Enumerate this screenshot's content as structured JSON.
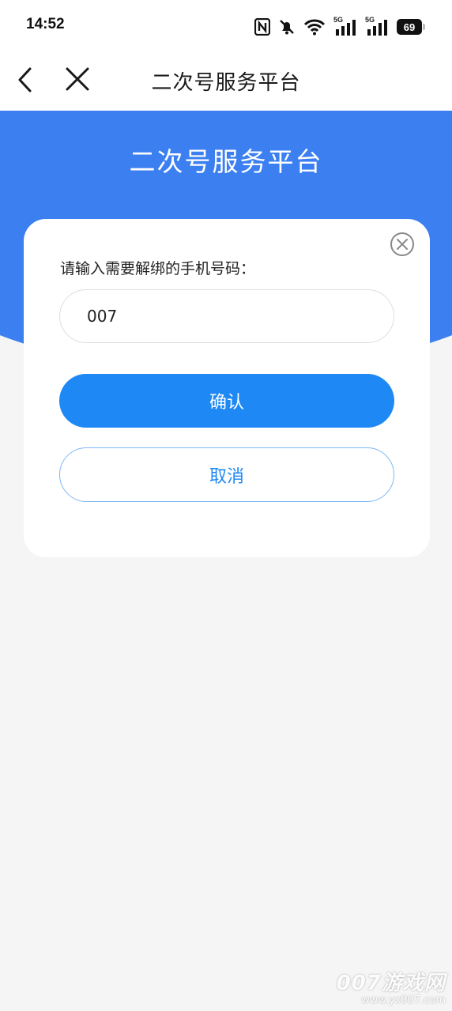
{
  "status_bar": {
    "time": "14:52",
    "battery_level": "69",
    "network_1": "5G",
    "network_2": "5G"
  },
  "nav": {
    "title": "二次号服务平台",
    "back_icon": "chevron-left-icon",
    "close_icon": "close-icon"
  },
  "hero": {
    "title": "二次号服务平台",
    "color": "#3b7ff0"
  },
  "dialog": {
    "prompt": "请输入需要解绑的手机号码：",
    "phone_value": "007",
    "confirm_label": "确认",
    "cancel_label": "取消",
    "accent_color": "#1e88f5",
    "close_icon": "circle-close-icon"
  },
  "watermark": {
    "brand": "007游戏网",
    "url": "www.yx007.com"
  }
}
